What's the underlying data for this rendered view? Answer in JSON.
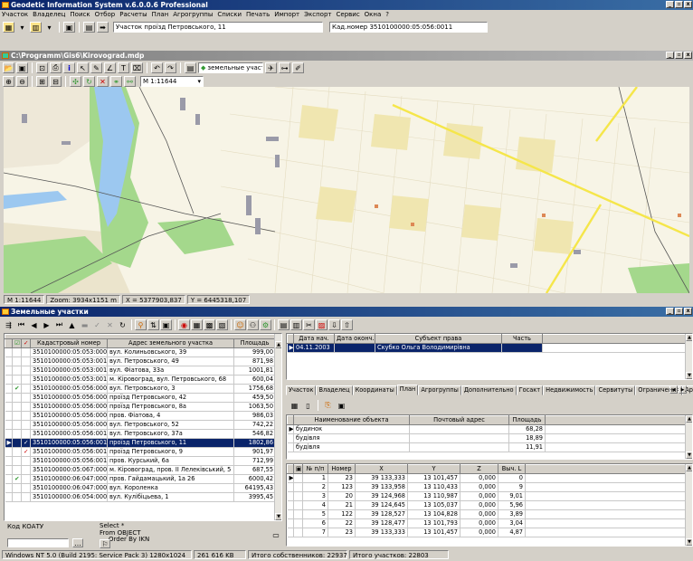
{
  "app": {
    "title": "Geodetic Information System v.6.0.0.6 Professional"
  },
  "menu": [
    "Участок",
    "Владелец",
    "Поиск",
    "Отбор",
    "Расчеты",
    "План",
    "Агрогруппы",
    "Списки",
    "Печать",
    "Импорт",
    "Экспорт",
    "Сервис",
    "Окна",
    "?"
  ],
  "main_toolbar": {
    "parcel_label": "Участок",
    "parcel_value": "проїзд Петровського, 11",
    "cad_label": "Кад.номер",
    "cad_value": "3510100000:05:056:0011"
  },
  "map_window": {
    "title": "C:\\Programm\\Gis6\\Kirovograd.mdp",
    "layer_label": "земельные участки",
    "scale_value": "М 1:11644"
  },
  "map_status": {
    "scale": "M 1:11644",
    "zoom": "Zoom: 3934x1151 m",
    "x": "X = 5377903,837",
    "y": "Y = 6445318,107"
  },
  "parcels_window": {
    "title": "Земельные участки"
  },
  "parcels_grid": {
    "headers": [
      "Кадастровый номер",
      "Адрес земельного участка",
      "Площадь"
    ],
    "rows": [
      {
        "check": "",
        "mark": "",
        "cad": "3510100000:05:053:0009",
        "addr": "вул. Колиньовського, 39",
        "area": "999,00"
      },
      {
        "check": "",
        "mark": "",
        "cad": "3510100000:05:053:0010",
        "addr": "вул. Петровського, 49",
        "area": "871,98"
      },
      {
        "check": "",
        "mark": "",
        "cad": "3510100000:05:053:0011",
        "addr": "вул. Фіатова, 33а",
        "area": "1001,81"
      },
      {
        "check": "",
        "mark": "",
        "cad": "3510100000:05:053:0012",
        "addr": "м. Кіровоград, вул. Петровського, 68",
        "area": "600,04"
      },
      {
        "check": "✔",
        "mark": "",
        "cad": "3510100000:05:056:0001",
        "addr": "вул. Петровського, 3",
        "area": "1756,68"
      },
      {
        "check": "",
        "mark": "",
        "cad": "3510100000:05:056:0002",
        "addr": "проїзд Петровського, 42",
        "area": "459,50"
      },
      {
        "check": "",
        "mark": "",
        "cad": "3510100000:05:056:0004",
        "addr": "проїзд Петровського, 8а",
        "area": "1063,50"
      },
      {
        "check": "",
        "mark": "",
        "cad": "3510100000:05:056:0007",
        "addr": "пров. Фіатова, 4",
        "area": "986,03"
      },
      {
        "check": "",
        "mark": "",
        "cad": "3510100000:05:056:0009",
        "addr": "вул. Петровського, 52",
        "area": "742,22"
      },
      {
        "check": "",
        "mark": "",
        "cad": "3510100000:05:056:0010",
        "addr": "вул. Петровського, 37а",
        "area": "546,82"
      },
      {
        "check": "",
        "mark": "✓",
        "cad": "3510100000:05:056:0011",
        "addr": "проїзд Петровського, 11",
        "area": "1802,86"
      },
      {
        "check": "",
        "mark": "✓",
        "cad": "3510100000:05:056:0012",
        "addr": "проїзд Петровського, 9",
        "area": "901,97"
      },
      {
        "check": "",
        "mark": "",
        "cad": "3510100000:05:056:0013",
        "addr": "пров. Курський, 6а",
        "area": "712,99"
      },
      {
        "check": "",
        "mark": "",
        "cad": "3510100000:05:067:0001",
        "addr": "м. Кіровоград, пров. ІІ Лелеківський, 5",
        "area": "687,55"
      },
      {
        "check": "✔",
        "mark": "",
        "cad": "3510100000:06:047:0001",
        "addr": "пров. Гайдамацький, 1а 26",
        "area": "6000,42"
      },
      {
        "check": "",
        "mark": "",
        "cad": "3510100000:06:047:0003",
        "addr": "вул. Короленка",
        "area": "64195,43"
      },
      {
        "check": "",
        "mark": "",
        "cad": "3510100000:06:054:0002",
        "addr": "вул. Кулібіцьева, 1",
        "area": "3995,45"
      }
    ]
  },
  "query": {
    "label": "Код КОАТУ",
    "text": [
      "Select *",
      "From OBJECT",
      "Order By IKN"
    ]
  },
  "owners_grid": {
    "headers": [
      "Дата нач.",
      "Дата оконч.",
      "Субъект права",
      "Часть"
    ],
    "rows": [
      {
        "start": "04.11.2003",
        "end": "",
        "subject": "Скубко Ольга Володимирівна",
        "part": ""
      }
    ]
  },
  "tabs": [
    "Участок",
    "Владелец",
    "Координаты",
    "План",
    "Агрогруппы",
    "Дополнительно",
    "Госакт",
    "Недвижимость",
    "Сервитуты",
    "Ограничения",
    "Аренда"
  ],
  "active_tab": "План",
  "objects_grid": {
    "headers": [
      "Наименование объекта",
      "Почтовый адрес",
      "Площадь"
    ],
    "rows": [
      {
        "name": "будинок",
        "addr": "",
        "area": "68,28"
      },
      {
        "name": "будівля",
        "addr": "",
        "area": "18,89"
      },
      {
        "name": "будівля",
        "addr": "",
        "area": "11,91"
      }
    ]
  },
  "coords_grid": {
    "headers": [
      "№ п/п",
      "Номер",
      "X",
      "Y",
      "Z",
      "Выч. L"
    ],
    "rows": [
      {
        "n": "1",
        "num": "23",
        "x": "39 133,333",
        "y": "13 101,457",
        "z": "0,000",
        "l": "0"
      },
      {
        "n": "2",
        "num": "123",
        "x": "39 133,958",
        "y": "13 110,433",
        "z": "0,000",
        "l": "9"
      },
      {
        "n": "3",
        "num": "20",
        "x": "39 124,968",
        "y": "13 110,987",
        "z": "0,000",
        "l": "9,01"
      },
      {
        "n": "4",
        "num": "21",
        "x": "39 124,645",
        "y": "13 105,037",
        "z": "0,000",
        "l": "5,96"
      },
      {
        "n": "5",
        "num": "122",
        "x": "39 128,527",
        "y": "13 104,828",
        "z": "0,000",
        "l": "3,89"
      },
      {
        "n": "6",
        "num": "22",
        "x": "39 128,477",
        "y": "13 101,793",
        "z": "0,000",
        "l": "3,04"
      },
      {
        "n": "7",
        "num": "23",
        "x": "39 133,333",
        "y": "13 101,457",
        "z": "0,000",
        "l": "4,87"
      }
    ]
  },
  "statusbar": {
    "os": "Windows NT 5.0 (Build 2195: Service Pack 3) 1280x1024",
    "mem": "261 616 KB",
    "owners": "Итого собственников: 22937",
    "parcels": "Итого участков: 22803"
  },
  "colors": {
    "titlebar": "#0a246a",
    "selection": "#0a246a",
    "map_bg": "#f7f4e6",
    "water": "#9cc8f0",
    "green": "#a4d88c",
    "road_main": "#f5e64a"
  }
}
